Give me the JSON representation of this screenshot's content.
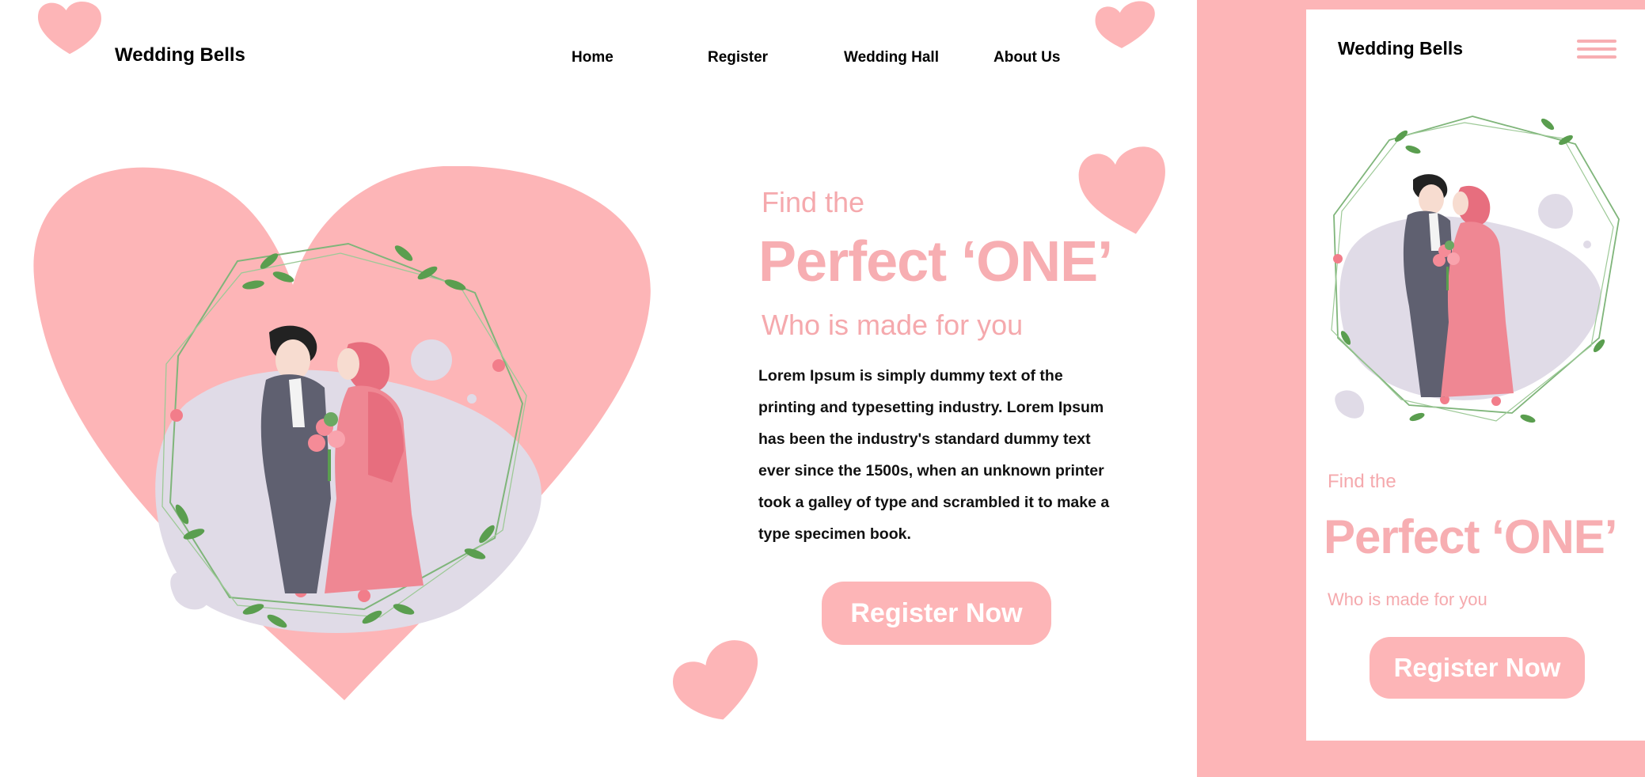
{
  "desktop": {
    "brand": "Wedding Bells",
    "nav": [
      "Home",
      "Register",
      "Wedding Hall",
      "About Us"
    ],
    "hero": {
      "line1": "Find the",
      "headline": "Perfect ‘ONE’",
      "line3": "Who is made for you",
      "body": "Lorem Ipsum is simply dummy text of the printing and typesetting industry. Lorem Ipsum has been the industry's standard dummy text ever since the 1500s, when an unknown printer took a galley of type and scrambled it to make a type specimen book.",
      "cta": "Register Now"
    }
  },
  "mobile": {
    "brand": "Wedding Bells",
    "hero": {
      "line1": "Find the",
      "headline": "Perfect ‘ONE’",
      "line3": "Who is made for you",
      "cta": "Register Now"
    }
  },
  "colors": {
    "accent": "#fdb5b7",
    "accent_text": "#f7aeb2",
    "blob": "#e0dbe7",
    "leaf": "#5a9e4f"
  },
  "icons": [
    "heart-icon",
    "hamburger-menu-icon"
  ]
}
